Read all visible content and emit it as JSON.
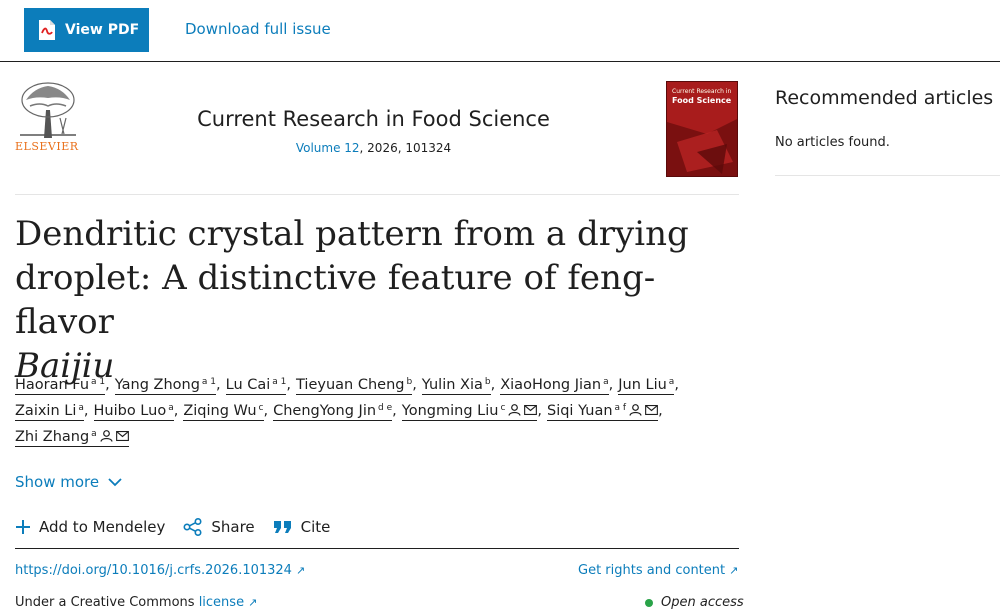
{
  "toolbar": {
    "view_pdf_label": "View PDF",
    "download_label": "Download full issue"
  },
  "journal": {
    "publisher": "ELSEVIER",
    "name": "Current Research in Food Science",
    "volume_link": "Volume 12",
    "meta_rest": ", 2026, 101324",
    "cover_header": "Current Research in",
    "cover_name": "Food Science"
  },
  "article": {
    "title_main": "Dendritic crystal pattern from a drying droplet: A distinctive feature of feng-flavor",
    "title_italic": "Baijiu",
    "authors": [
      {
        "name": "Haoran Fu",
        "sup": "a 1",
        "person": false,
        "mail": false
      },
      {
        "name": "Yang Zhong",
        "sup": "a 1",
        "person": false,
        "mail": false
      },
      {
        "name": "Lu Cai",
        "sup": "a 1",
        "person": false,
        "mail": false
      },
      {
        "name": "Tieyuan Cheng",
        "sup": "b",
        "person": false,
        "mail": false
      },
      {
        "name": "Yulin Xia",
        "sup": "b",
        "person": false,
        "mail": false
      },
      {
        "name": "XiaoHong Jian",
        "sup": "a",
        "person": false,
        "mail": false
      },
      {
        "name": "Jun Liu",
        "sup": "a",
        "person": false,
        "mail": false
      },
      {
        "name": "Zaixin Li",
        "sup": "a",
        "person": false,
        "mail": false
      },
      {
        "name": "Huibo Luo",
        "sup": "a",
        "person": false,
        "mail": false
      },
      {
        "name": "Ziqing Wu",
        "sup": "c",
        "person": false,
        "mail": false
      },
      {
        "name": "ChengYong Jin",
        "sup": "d e",
        "person": false,
        "mail": false
      },
      {
        "name": "Yongming Liu",
        "sup": "c",
        "person": true,
        "mail": true
      },
      {
        "name": "Siqi Yuan",
        "sup": "a f",
        "person": true,
        "mail": true
      },
      {
        "name": "Zhi Zhang",
        "sup": "a",
        "person": true,
        "mail": true
      }
    ],
    "show_more": "Show more",
    "actions": {
      "mendeley": "Add to Mendeley",
      "share": "Share",
      "cite": "Cite"
    },
    "doi": "https://doi.org/10.1016/j.crfs.2026.101324",
    "rights": "Get rights and content",
    "license_prefix": "Under a Creative Commons",
    "license_link": "license",
    "open_access": "Open access"
  },
  "sidebar": {
    "title": "Recommended articles",
    "empty": "No articles found."
  },
  "colors": {
    "accent": "#0c7dbb",
    "elsevier_orange": "#e9711c",
    "open_access_green": "#29a348",
    "cover_red": "#a81c1c"
  },
  "icons": [
    "pdf-icon",
    "elsevier-tree-logo",
    "person-icon",
    "mail-icon",
    "chevron-down-icon",
    "plus-icon",
    "share-icon",
    "quote-icon",
    "external-arrow-icon"
  ]
}
